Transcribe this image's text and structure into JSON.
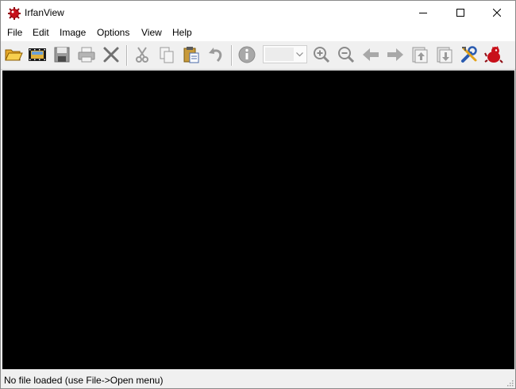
{
  "window": {
    "title": "IrfanView"
  },
  "menu": {
    "items": [
      {
        "label": "File"
      },
      {
        "label": "Edit"
      },
      {
        "label": "Image"
      },
      {
        "label": "Options"
      },
      {
        "label": "View"
      },
      {
        "label": "Help"
      }
    ]
  },
  "toolbar": {
    "zoom_value": ""
  },
  "status": {
    "text": "No file loaded (use File->Open menu)"
  },
  "colors": {
    "viewport_bg": "#000000",
    "titlebar_bg": "#ffffff",
    "chrome_bg": "#f0f0f0",
    "accent_red": "#c8101a"
  }
}
